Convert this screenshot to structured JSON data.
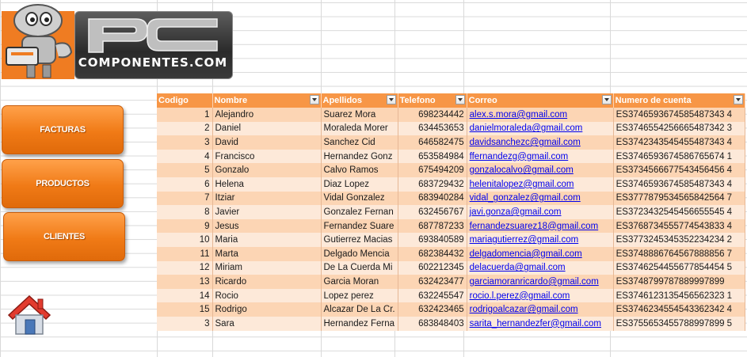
{
  "logo": {
    "pc": "PC",
    "text": "COMPONENTES.COM"
  },
  "nav": {
    "facturas": "FACTURAS",
    "productos": "PRODUCTOS",
    "clientes": "CLIENTES",
    "home_icon": "home-icon"
  },
  "colors": {
    "header": "#f79646",
    "row_dark": "#fcd5b4",
    "row_light": "#fde9d9",
    "button": "#f07a16"
  },
  "table": {
    "headers": [
      "Codigo",
      "Nombre",
      "Apellidos",
      "Telefono",
      "Correo",
      "Numero de cuenta"
    ],
    "rows": [
      [
        "1",
        "Alejandro",
        "Suarez Mora",
        "698234442",
        "alex.s.mora@gmail.com",
        "ES3746593674585487343 4"
      ],
      [
        "2",
        "Daniel",
        "Moraleda Morer",
        "634453653",
        "danielmoraleda@gmail.com",
        "ES3746554256665487342 3"
      ],
      [
        "3",
        "David",
        "Sanchez Cid",
        "646582475",
        "davidsanchezc@gmail.com",
        "ES3742343545455487343 4"
      ],
      [
        "4",
        "Francisco",
        "Hernandez Gonz",
        "653584984",
        "ffernandezg@gmail.com",
        "ES3746593674586765674 1"
      ],
      [
        "5",
        "Gonzalo",
        "Calvo Ramos",
        "675494209",
        "gonzalocalvo@gmail.com",
        "ES3734566677543456456 4"
      ],
      [
        "6",
        "Helena",
        "Diaz Lopez",
        "683729432",
        "helenitalopez@gmail.com",
        "ES3746593674585487343 4"
      ],
      [
        "7",
        "Itziar",
        "Vidal Gonzalez",
        "683940284",
        "vidal_gonzalez@gmail.com",
        "ES3777879534565842564 7"
      ],
      [
        "8",
        "Javier",
        "Gonzalez Fernan",
        "632456767",
        "javi.gonza@gmail.com",
        "ES3723432545456655545 4"
      ],
      [
        "9",
        "Jesus",
        "Fernandez Suare",
        "687787233",
        "fernandezsuarez18@gmail.com",
        "ES3768734555774543833 4"
      ],
      [
        "10",
        "Maria",
        "Gutierrez Macias",
        "693840589",
        "mariagutierrez@gmail.com",
        "ES3773245345352234234 2"
      ],
      [
        "11",
        "Marta",
        "Delgado Mencia",
        "682384432",
        "delgadomencia@gmail.com",
        "ES3748886764567888856 7"
      ],
      [
        "12",
        "Miriam",
        "De La Cuerda Mi",
        "602212345",
        "delacuerda@gmail.com",
        "ES3746254455677854454 5"
      ],
      [
        "13",
        "Ricardo",
        "Garcia Moran",
        "632423477",
        "garciamoranricardo@gmail.com",
        "ES3748799787889997899"
      ],
      [
        "14",
        "Rocio",
        "Lopez perez",
        "632245547",
        "rocio.l.perez@gmail.com",
        "ES3746123135456562323 1"
      ],
      [
        "15",
        "Rodrigo",
        "Alcazar De La Cr.",
        "632423465",
        "rodrigoalcazar@gmail.com",
        "ES3746234554543362342 4"
      ],
      [
        "3",
        "Sara",
        "Hernandez Ferna",
        "683848403",
        "sarita_hernandezfer@gmail.com",
        "ES3755653455788997899 5"
      ]
    ]
  }
}
